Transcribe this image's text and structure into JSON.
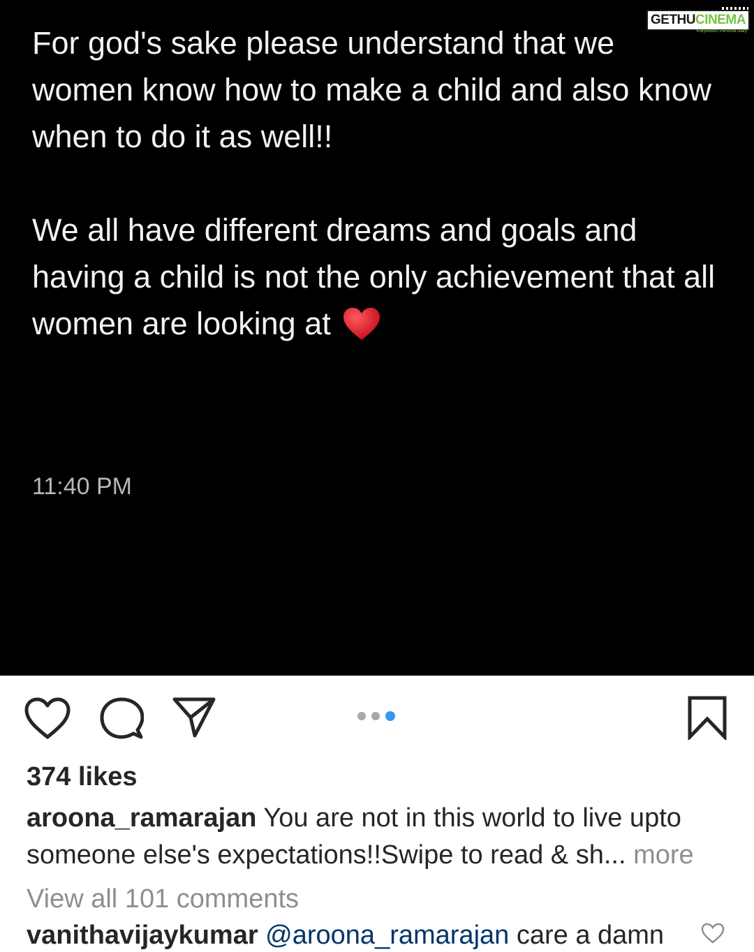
{
  "post": {
    "paragraph1": "For god's sake please understand that we women know how to make a child and also know when to do it as well!!",
    "paragraph2": "We all have different dreams and goals and having a child is not the only achievement that all women are looking at",
    "emoji": "red-heart-emoji",
    "time": "11:40 PM"
  },
  "watermark": {
    "part1": "GETHU",
    "part2": "CINEMA",
    "tagline": "Kollywood's Personal Diary"
  },
  "actions": {
    "like_icon": "heart-outline-icon",
    "comment_icon": "comment-bubble-icon",
    "share_icon": "paper-plane-icon",
    "save_icon": "bookmark-icon",
    "carousel_count": 3,
    "carousel_active_index": 3
  },
  "likes": "374 likes",
  "caption": {
    "username": "aroona_ramarajan",
    "text": "You are not in this world to live upto someone else's expectations!!Swipe to read & sh...",
    "more": " more"
  },
  "view_comments": "View all 101 comments",
  "comment": {
    "username": "vanithavijaykumar",
    "mention": "@aroona_ramarajan",
    "text": "care a damn"
  },
  "colors": {
    "post_bg": "#000000",
    "post_text": "#f2f2f2",
    "accent_blue": "#3897f0",
    "muted": "#8e8e8e",
    "heart_red": "#d8202f"
  }
}
